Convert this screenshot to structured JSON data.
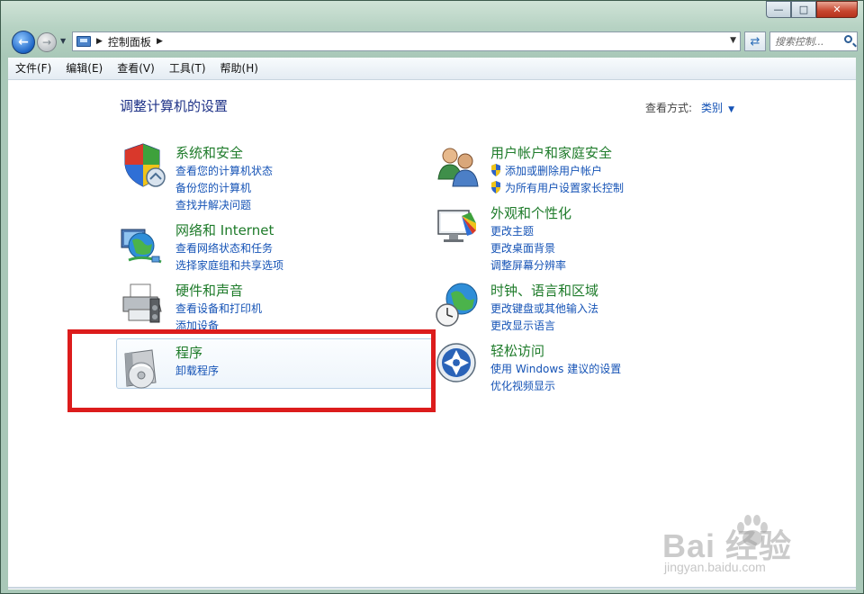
{
  "window": {
    "caption": {
      "minimize_glyph": "—",
      "maximize_glyph": "□",
      "close_glyph": "✕"
    }
  },
  "navigation": {
    "back_icon": "back-arrow-icon",
    "forward_icon": "forward-arrow-icon",
    "breadcrumb": [
      "控制面板"
    ],
    "search_placeholder": "搜索控制..."
  },
  "menubar": {
    "items": [
      "文件(F)",
      "编辑(E)",
      "查看(V)",
      "工具(T)",
      "帮助(H)"
    ]
  },
  "content": {
    "title": "调整计算机的设置",
    "view_by_label": "查看方式:",
    "view_by_value": "类别",
    "categories": [
      {
        "title": "系统和安全",
        "icon": "shield-icon",
        "links": [
          {
            "label": "查看您的计算机状态"
          },
          {
            "label": "备份您的计算机"
          },
          {
            "label": "查找并解决问题"
          }
        ]
      },
      {
        "title": "网络和 Internet",
        "icon": "network-globe-icon",
        "links": [
          {
            "label": "查看网络状态和任务"
          },
          {
            "label": "选择家庭组和共享选项"
          }
        ]
      },
      {
        "title": "硬件和声音",
        "icon": "printer-icon",
        "links": [
          {
            "label": "查看设备和打印机"
          },
          {
            "label": "添加设备"
          }
        ]
      },
      {
        "title": "程序",
        "icon": "programs-disc-icon",
        "highlighted": true,
        "links": [
          {
            "label": "卸载程序"
          }
        ]
      },
      {
        "title": "用户帐户和家庭安全",
        "icon": "users-icon",
        "links": [
          {
            "label": "添加或删除用户帐户",
            "uac_shield": true
          },
          {
            "label": "为所有用户设置家长控制",
            "uac_shield": true
          }
        ]
      },
      {
        "title": "外观和个性化",
        "icon": "monitor-palette-icon",
        "links": [
          {
            "label": "更改主题"
          },
          {
            "label": "更改桌面背景"
          },
          {
            "label": "调整屏幕分辨率"
          }
        ]
      },
      {
        "title": "时钟、语言和区域",
        "icon": "globe-clock-icon",
        "links": [
          {
            "label": "更改键盘或其他输入法"
          },
          {
            "label": "更改显示语言"
          }
        ]
      },
      {
        "title": "轻松访问",
        "icon": "ease-of-access-icon",
        "links": [
          {
            "label": "使用 Windows 建议的设置"
          },
          {
            "label": "优化视频显示"
          }
        ]
      }
    ]
  },
  "annotation": {
    "highlight_color": "#dc1c1c"
  },
  "watermark": {
    "text": "Bai 经验",
    "url": "jingyan.baidu.com"
  }
}
